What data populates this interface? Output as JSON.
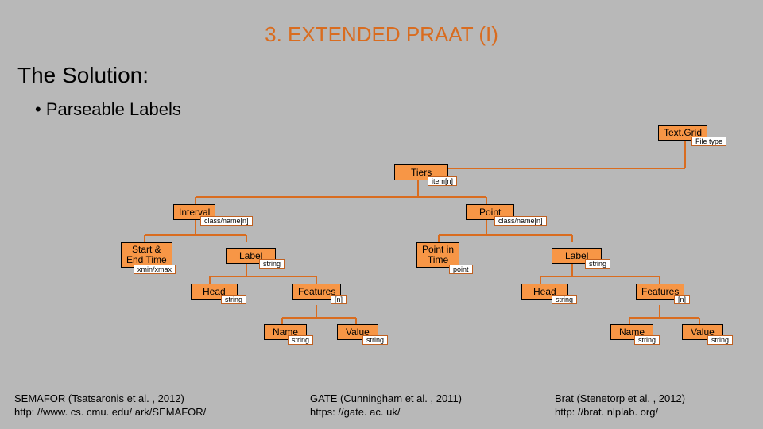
{
  "title": "3. EXTENDED PRAAT (I)",
  "subtitle": "The Solution:",
  "bullet": "Parseable Labels",
  "nodes": {
    "textgrid": "Text.Grid",
    "textgrid_tag": "File type",
    "tiers": "Tiers",
    "tiers_tag": "item[n]",
    "interval": "Interval",
    "interval_tag": "class/name[n]",
    "point_top": "Point",
    "point_top_tag": "class/name[n]",
    "startend": "Start &",
    "startend2": "End Time",
    "startend_tag": "xmin/xmax",
    "label1": "Label",
    "label1_tag": "string",
    "pointintime": "Point in",
    "pointintime2": "Time",
    "pointintime_tag": "point",
    "label2": "Label",
    "label2_tag": "string",
    "head1": "Head",
    "head1_tag": "string",
    "features1": "Features",
    "features1_tag": "[n]",
    "head2": "Head",
    "head2_tag": "string",
    "features2": "Features",
    "features2_tag": "[n]",
    "name1": "Name",
    "name1_tag": "string",
    "value1": "Value",
    "value1_tag": "string",
    "name2": "Name",
    "name2_tag": "string",
    "value2": "Value",
    "value2_tag": "string"
  },
  "footer": {
    "left1": "SEMAFOR (Tsatsaronis et al. , 2012)",
    "left2": "http: //www. cs. cmu. edu/ ark/SEMAFOR/",
    "mid1": "GATE (Cunningham et al. , 2011)",
    "mid2": "https: //gate. ac. uk/",
    "right1": "Brat (Stenetorp et al. , 2012)",
    "right2": "http: //brat. nlplab. org/"
  }
}
